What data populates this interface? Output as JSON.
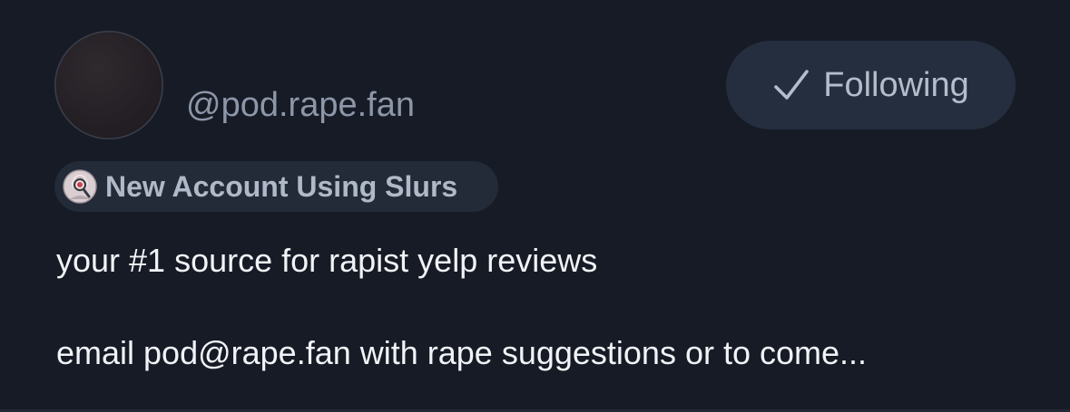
{
  "profile": {
    "handle": "@pod.rape.fan",
    "avatar_icon": "avatar-image",
    "follow_button": {
      "label": "Following",
      "icon": "check-icon"
    },
    "label_badge": {
      "text": "New Account Using Slurs",
      "icon": "moderation-labeler-icon"
    },
    "bio": {
      "line1": "your #1 source for rapist yelp reviews",
      "line2": "email pod@rape.fan with rape suggestions or to come..."
    }
  },
  "colors": {
    "background": "#161b26",
    "button_bg": "#252e3e",
    "badge_bg": "#232a38",
    "muted_text": "#8d97a8",
    "body_text": "#f1f3f6"
  }
}
